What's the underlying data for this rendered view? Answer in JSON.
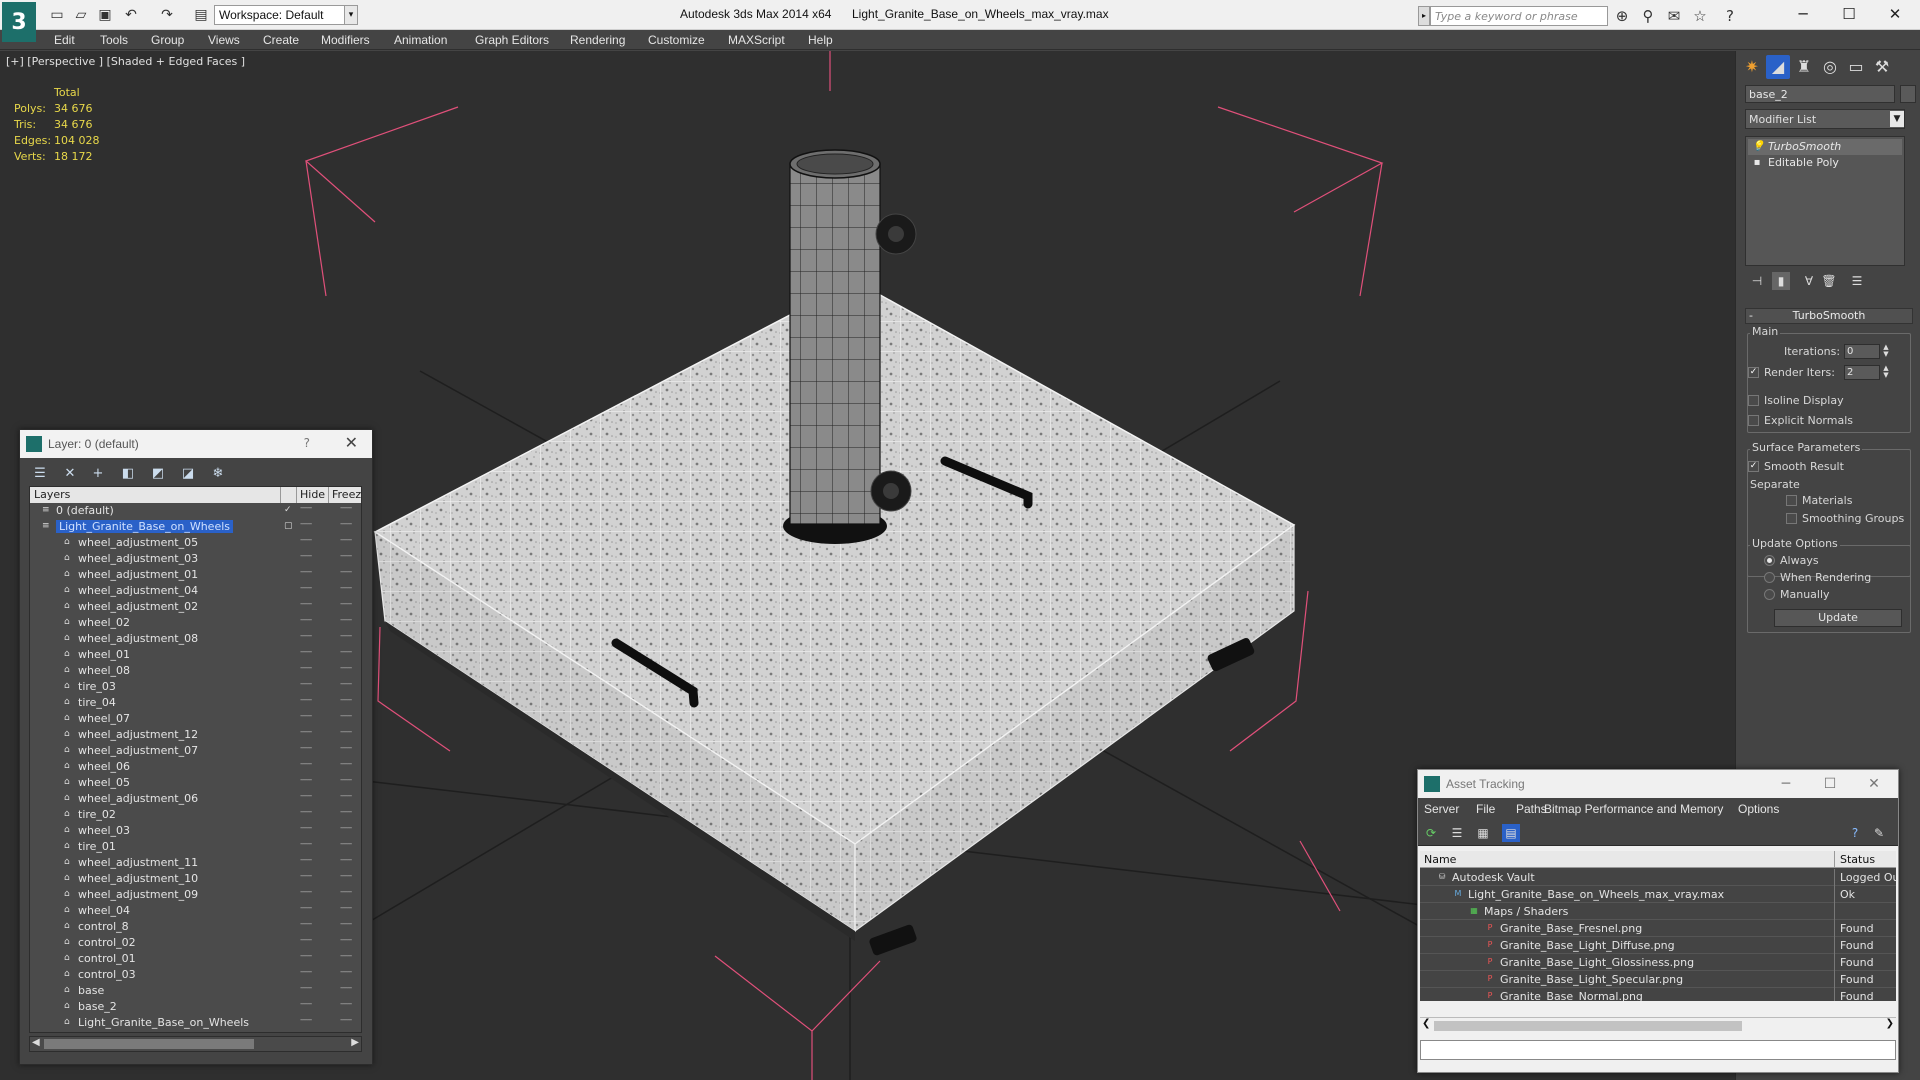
{
  "titlebar": {
    "workspace": "Workspace: Default",
    "app_title": "Autodesk 3ds Max  2014 x64",
    "file_title": "Light_Granite_Base_on_Wheels_max_vray.max",
    "search_placeholder": "Type a keyword or phrase"
  },
  "menu": [
    "Edit",
    "Tools",
    "Group",
    "Views",
    "Create",
    "Modifiers",
    "Animation",
    "Graph Editors",
    "Rendering",
    "Customize",
    "MAXScript",
    "Help"
  ],
  "viewport": {
    "label": "[+] [Perspective ] [Shaded + Edged Faces ]",
    "stats_header": "Total",
    "stats": [
      {
        "label": "Polys:",
        "value": "34 676"
      },
      {
        "label": "Tris:",
        "value": "34 676"
      },
      {
        "label": "Edges:",
        "value": "104 028"
      },
      {
        "label": "Verts:",
        "value": "18 172"
      }
    ]
  },
  "command_panel": {
    "object_name": "base_2",
    "modifier_list": "Modifier List",
    "stack": [
      "TurboSmooth",
      "Editable Poly"
    ],
    "rollout_title": "TurboSmooth",
    "main_group": "Main",
    "iterations_label": "Iterations:",
    "iterations_value": "0",
    "render_iters_label": "Render Iters:",
    "render_iters_value": "2",
    "isoline_label": "Isoline Display",
    "explicit_label": "Explicit Normals",
    "surface_group": "Surface Parameters",
    "smooth_result_label": "Smooth Result",
    "separate_label": "Separate",
    "materials_label": "Materials",
    "smoothing_groups_label": "Smoothing Groups",
    "update_group": "Update Options",
    "always_label": "Always",
    "when_rendering_label": "When Rendering",
    "manually_label": "Manually",
    "update_button": "Update"
  },
  "layer_window": {
    "title": "Layer: 0 (default)",
    "help": "?",
    "columns": {
      "layers": "Layers",
      "hide": "Hide",
      "freeze": "Freeze"
    },
    "layers": [
      {
        "name": "0 (default)",
        "type": "layer",
        "indent": 1,
        "check": true
      },
      {
        "name": "Light_Granite_Base_on_Wheels",
        "type": "layer",
        "indent": 1,
        "selected": true
      },
      {
        "name": "wheel_adjustment_05",
        "type": "object",
        "indent": 2
      },
      {
        "name": "wheel_adjustment_03",
        "type": "object",
        "indent": 2
      },
      {
        "name": "wheel_adjustment_01",
        "type": "object",
        "indent": 2
      },
      {
        "name": "wheel_adjustment_04",
        "type": "object",
        "indent": 2
      },
      {
        "name": "wheel_adjustment_02",
        "type": "object",
        "indent": 2
      },
      {
        "name": "wheel_02",
        "type": "object",
        "indent": 2
      },
      {
        "name": "wheel_adjustment_08",
        "type": "object",
        "indent": 2
      },
      {
        "name": "wheel_01",
        "type": "object",
        "indent": 2
      },
      {
        "name": "wheel_08",
        "type": "object",
        "indent": 2
      },
      {
        "name": "tire_03",
        "type": "object",
        "indent": 2
      },
      {
        "name": "tire_04",
        "type": "object",
        "indent": 2
      },
      {
        "name": "wheel_07",
        "type": "object",
        "indent": 2
      },
      {
        "name": "wheel_adjustment_12",
        "type": "object",
        "indent": 2
      },
      {
        "name": "wheel_adjustment_07",
        "type": "object",
        "indent": 2
      },
      {
        "name": "wheel_06",
        "type": "object",
        "indent": 2
      },
      {
        "name": "wheel_05",
        "type": "object",
        "indent": 2
      },
      {
        "name": "wheel_adjustment_06",
        "type": "object",
        "indent": 2
      },
      {
        "name": "tire_02",
        "type": "object",
        "indent": 2
      },
      {
        "name": "wheel_03",
        "type": "object",
        "indent": 2
      },
      {
        "name": "tire_01",
        "type": "object",
        "indent": 2
      },
      {
        "name": "wheel_adjustment_11",
        "type": "object",
        "indent": 2
      },
      {
        "name": "wheel_adjustment_10",
        "type": "object",
        "indent": 2
      },
      {
        "name": "wheel_adjustment_09",
        "type": "object",
        "indent": 2
      },
      {
        "name": "wheel_04",
        "type": "object",
        "indent": 2
      },
      {
        "name": "control_8",
        "type": "object",
        "indent": 2
      },
      {
        "name": "control_02",
        "type": "object",
        "indent": 2
      },
      {
        "name": "control_01",
        "type": "object",
        "indent": 2
      },
      {
        "name": "control_03",
        "type": "object",
        "indent": 2
      },
      {
        "name": "base",
        "type": "object",
        "indent": 2
      },
      {
        "name": "base_2",
        "type": "object",
        "indent": 2
      },
      {
        "name": "Light_Granite_Base_on_Wheels",
        "type": "object",
        "indent": 2
      }
    ]
  },
  "asset_window": {
    "title": "Asset Tracking",
    "menu": [
      "Server",
      "File",
      "Paths",
      "Bitmap Performance and Memory",
      "Options"
    ],
    "columns": {
      "name": "Name",
      "status": "Status"
    },
    "rows": [
      {
        "name": "Autodesk Vault",
        "status": "Logged Ou",
        "indent": 1,
        "icon": "vault"
      },
      {
        "name": "Light_Granite_Base_on_Wheels_max_vray.max",
        "status": "Ok",
        "indent": 2,
        "icon": "max"
      },
      {
        "name": "Maps / Shaders",
        "status": "",
        "indent": 3,
        "icon": "maps"
      },
      {
        "name": "Granite_Base_Fresnel.png",
        "status": "Found",
        "indent": 4,
        "icon": "png"
      },
      {
        "name": "Granite_Base_Light_Diffuse.png",
        "status": "Found",
        "indent": 4,
        "icon": "png"
      },
      {
        "name": "Granite_Base_Light_Glossiness.png",
        "status": "Found",
        "indent": 4,
        "icon": "png"
      },
      {
        "name": "Granite_Base_Light_Specular.png",
        "status": "Found",
        "indent": 4,
        "icon": "png"
      },
      {
        "name": "Granite_Base_Normal.png",
        "status": "Found",
        "indent": 4,
        "icon": "png"
      }
    ]
  },
  "colors": {
    "selection": "#2a61c8",
    "stats": "#e8d84a",
    "bbox": "#e0507a"
  }
}
